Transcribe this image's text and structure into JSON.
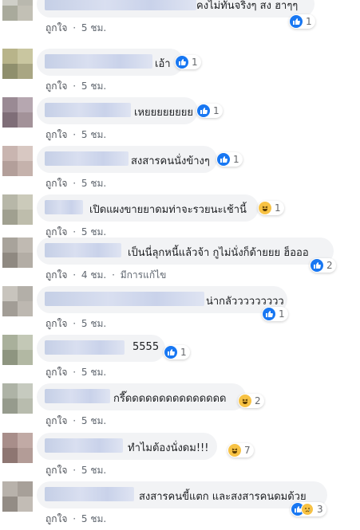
{
  "like_label": "ถูกใจ",
  "dot": "·",
  "comments": [
    {
      "text": "คงไม่ทันจริงๆ สง ฮาๆๆ",
      "reactions": [
        "like"
      ],
      "count": "1",
      "time": "5 ชม.",
      "edited": ""
    },
    {
      "text": "เอ้า",
      "reactions": [
        "like"
      ],
      "count": "1",
      "time": "5 ชม.",
      "edited": ""
    },
    {
      "text": "เหยยยยยยยย",
      "reactions": [
        "like"
      ],
      "count": "1",
      "time": "5 ชม.",
      "edited": ""
    },
    {
      "text": "สงสารคนนั่งข้างๆ",
      "reactions": [
        "like"
      ],
      "count": "1",
      "time": "5 ชม.",
      "edited": ""
    },
    {
      "text": "เปิดแผงขายยาดมท่าจะรวยนะเช้านี้",
      "reactions": [
        "haha"
      ],
      "count": "1",
      "time": "5 ชม.",
      "edited": ""
    },
    {
      "text": "เป็นนี่ลุกหนี้แล้วจ้า กูไม่นั่งก็ด้ายยย ฮ็อออ",
      "reactions": [
        "like"
      ],
      "count": "2",
      "time": "4 ชม.",
      "edited": "มีการแก้ไข"
    },
    {
      "text": "น่ากลัววววววววว",
      "reactions": [
        "like"
      ],
      "count": "1",
      "time": "5 ชม.",
      "edited": ""
    },
    {
      "text": "5555",
      "reactions": [
        "like"
      ],
      "count": "1",
      "time": "5 ชม.",
      "edited": ""
    },
    {
      "text": "กรี๊ดดดดดดดดดดดดดดด",
      "reactions": [
        "haha"
      ],
      "count": "2",
      "time": "5 ชม.",
      "edited": ""
    },
    {
      "text": "ทำไมต้องนั่งดม!!!",
      "reactions": [
        "haha"
      ],
      "count": "7",
      "time": "5 ชม.",
      "edited": ""
    },
    {
      "text": "สงสารคนขี้แตก และสงสารคนดมด้วย",
      "reactions": [
        "like",
        "sad"
      ],
      "count": "3",
      "time": "5 ชม.",
      "edited": ""
    }
  ]
}
